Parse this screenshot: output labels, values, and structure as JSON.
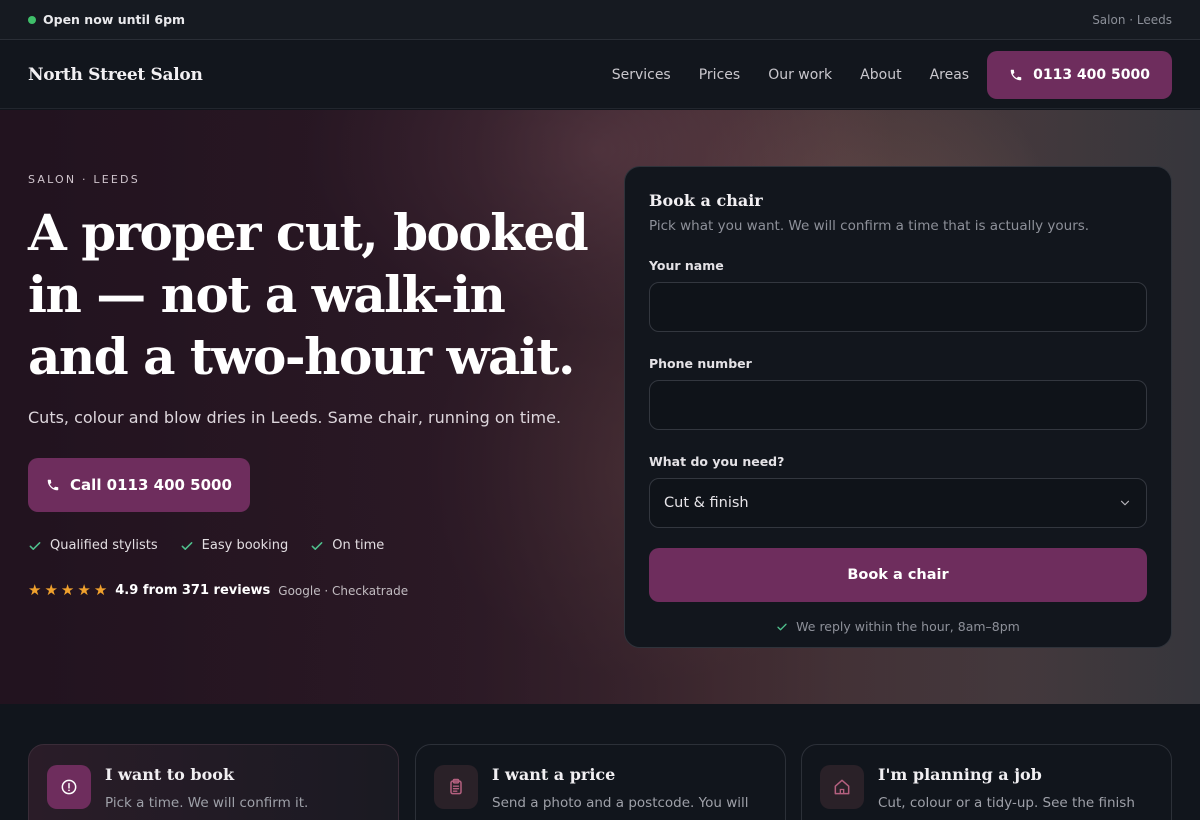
{
  "topbar": {
    "status": "Open now until 6pm",
    "location": "Salon · Leeds",
    "status_color": "#3fbf6a"
  },
  "navbar": {
    "brand": "North Street Salon",
    "links": [
      "Services",
      "Prices",
      "Our work",
      "About",
      "Areas"
    ],
    "call_label": "0113 400 5000"
  },
  "hero": {
    "eyebrow": "SALON · LEEDS",
    "headline": "A proper cut, booked in — not a walk-in and a two-hour wait.",
    "subhead": "Cuts, colour and blow dries in Leeds. Same chair, running on time.",
    "call_label": "Call 0113 400 5000",
    "checks": [
      "Qualified stylists",
      "Easy booking",
      "On time"
    ],
    "rating": "4.9 from 371 reviews",
    "rating_sources": "Google · Checkatrade",
    "stars": 5
  },
  "form": {
    "title": "Book a chair",
    "subtitle": "Pick what you want. We will confirm a time that is actually yours.",
    "name_label": "Your name",
    "name_value": "",
    "phone_label": "Phone number",
    "phone_value": "",
    "need_label": "What do you need?",
    "need_value": "Cut & finish",
    "submit_label": "Book a chair",
    "reply_note": "We reply within the hour, 8am–8pm"
  },
  "cards": [
    {
      "title": "I want to book",
      "desc": "Pick a time. We will confirm it.",
      "icon": "alert-circle-icon"
    },
    {
      "title": "I want a price",
      "desc": "Send a photo and a postcode. You will",
      "icon": "clipboard-icon"
    },
    {
      "title": "I'm planning a job",
      "desc": "Cut, colour or a tidy-up. See the finish",
      "icon": "home-icon"
    }
  ],
  "colors": {
    "accent": "#6e2d5d",
    "check": "#4fc08d",
    "star": "#f0a12d",
    "background": "#11151c"
  }
}
